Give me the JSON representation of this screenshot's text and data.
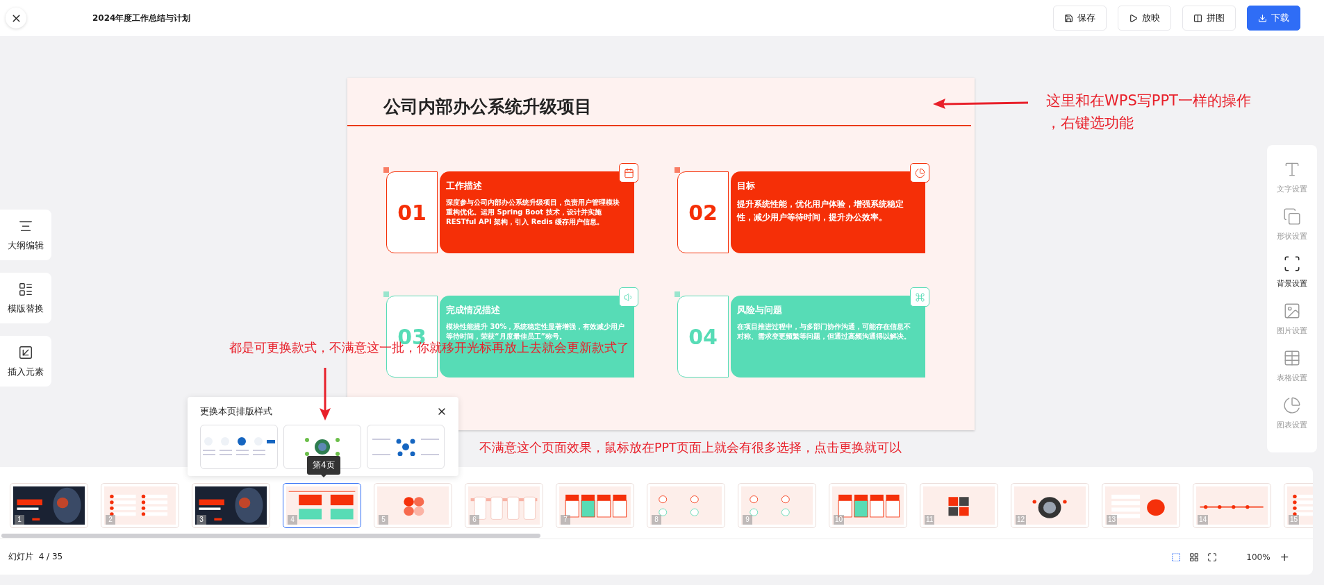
{
  "header": {
    "title": "2024年度工作总结与计划",
    "actions": [
      {
        "label": "保存",
        "kind": "save",
        "primary": false
      },
      {
        "label": "放映",
        "kind": "play",
        "primary": false
      },
      {
        "label": "拼图",
        "kind": "collage",
        "primary": false
      },
      {
        "label": "下载",
        "kind": "download",
        "primary": true
      }
    ]
  },
  "left_tools": [
    {
      "label": "大纲编辑",
      "kind": "outline"
    },
    {
      "label": "模版替换",
      "kind": "template"
    },
    {
      "label": "插入元素",
      "kind": "insert"
    }
  ],
  "slide": {
    "title": "公司内部办公系统升级项目",
    "cards": [
      {
        "number": "01",
        "title": "工作描述",
        "body": "深度参与公司内部办公系统升级项目，负责用户管理模块重构优化。运用 Spring Boot 技术，设计并实施 RESTful API 架构，引入 Redis 缓存用户信息。",
        "color": "#f52f07",
        "kind": "calendar"
      },
      {
        "number": "02",
        "title": "目标",
        "body": "提升系统性能，优化用户体验，增强系统稳定性，减少用户等待时间，提升办公效率。",
        "color": "#f52f07",
        "kind": "pie"
      },
      {
        "number": "03",
        "title": "完成情况描述",
        "body": "模块性能提升 30%，系统稳定性显著增强，有效减少用户等待时间，荣获“月度最佳员工”称号。",
        "color": "#57dcb6",
        "kind": "speaker"
      },
      {
        "number": "04",
        "title": "风险与问题",
        "body": "在项目推进过程中，与多部门协作沟通，可能存在信息不对称、需求变更频繁等问题，但通过高频沟通得以解决。",
        "color": "#57dcb6",
        "kind": "command"
      }
    ]
  },
  "right_panel": [
    {
      "label": "文字设置",
      "kind": "text",
      "selected": false
    },
    {
      "label": "形状设置",
      "kind": "shape",
      "selected": false
    },
    {
      "label": "背景设置",
      "kind": "background",
      "selected": true
    },
    {
      "label": "图片设置",
      "kind": "image",
      "selected": false
    },
    {
      "label": "表格设置",
      "kind": "table",
      "selected": false
    },
    {
      "label": "图表设置",
      "kind": "chart",
      "selected": false
    }
  ],
  "layout_popup": {
    "title": "更换本页排版样式",
    "options": [
      {
        "kind": "steps"
      },
      {
        "kind": "hub"
      },
      {
        "kind": "network"
      }
    ]
  },
  "tooltip": "第4页",
  "filmstrip": {
    "slides": [
      {
        "number": "1",
        "kind": "photo",
        "selected": false
      },
      {
        "number": "2",
        "kind": "contents",
        "selected": false
      },
      {
        "number": "3",
        "kind": "photo",
        "selected": false
      },
      {
        "number": "4",
        "kind": "cards",
        "selected": true
      },
      {
        "number": "5",
        "kind": "circles",
        "selected": false
      },
      {
        "number": "6",
        "kind": "steps",
        "selected": false
      },
      {
        "number": "7",
        "kind": "columns",
        "selected": false
      },
      {
        "number": "8",
        "kind": "icons",
        "selected": false
      },
      {
        "number": "9",
        "kind": "icons",
        "selected": false
      },
      {
        "number": "10",
        "kind": "columns",
        "selected": false
      },
      {
        "number": "11",
        "kind": "grid",
        "selected": false
      },
      {
        "number": "12",
        "kind": "donut",
        "selected": false
      },
      {
        "number": "13",
        "kind": "bubbles",
        "selected": false
      },
      {
        "number": "14",
        "kind": "timeline",
        "selected": false
      },
      {
        "number": "15",
        "kind": "contents",
        "selected": false
      }
    ],
    "counter_label": "幻灯片",
    "counter": "4 / 35",
    "zoom": "100%",
    "zoom_in": "+"
  },
  "annotations": [
    {
      "lines": [
        "这里和在WPS写PPT一样的操作",
        "，右键选功能"
      ],
      "kind": "left"
    },
    {
      "lines": [
        "都是可更换款式，不满意这一批，你就移开光标再放上去就会更新款式了"
      ],
      "kind": "down"
    },
    {
      "lines": [
        "不满意这个页面效果，鼠标放在PPT页面上就会有很多选择，点击更换就可以"
      ],
      "kind": "plain"
    }
  ]
}
